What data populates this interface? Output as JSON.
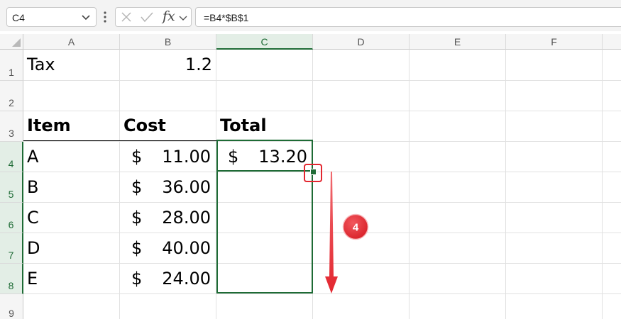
{
  "formula_bar": {
    "name_box": "C4",
    "formula": "=B4*$B$1",
    "insert_function_symbol": "fx",
    "icons": [
      "chevron-down-icon",
      "more-vertical-icon",
      "cancel-icon",
      "check-icon",
      "function-icon"
    ]
  },
  "columns": [
    "A",
    "B",
    "C",
    "D",
    "E",
    "F"
  ],
  "rows": [
    "1",
    "2",
    "3",
    "4",
    "5",
    "6",
    "7",
    "8",
    "9"
  ],
  "sheet": {
    "a1": "Tax",
    "b1": "1.2",
    "a3": "Item",
    "b3": "Cost",
    "c3": "Total",
    "items": [
      {
        "item": "A",
        "currency": "$",
        "cost": "11.00"
      },
      {
        "item": "B",
        "currency": "$",
        "cost": "36.00"
      },
      {
        "item": "C",
        "currency": "$",
        "cost": "28.00"
      },
      {
        "item": "D",
        "currency": "$",
        "cost": "40.00"
      },
      {
        "item": "E",
        "currency": "$",
        "cost": "24.00"
      }
    ],
    "c4": {
      "currency": "$",
      "value": "13.20"
    }
  },
  "selection": {
    "active_cell": "C4",
    "range": "C4:C8"
  },
  "annotation": {
    "step_number": "4",
    "color": "#e3262f"
  },
  "colors": {
    "accent": "#1e6b35",
    "annotation": "#e3262f"
  }
}
